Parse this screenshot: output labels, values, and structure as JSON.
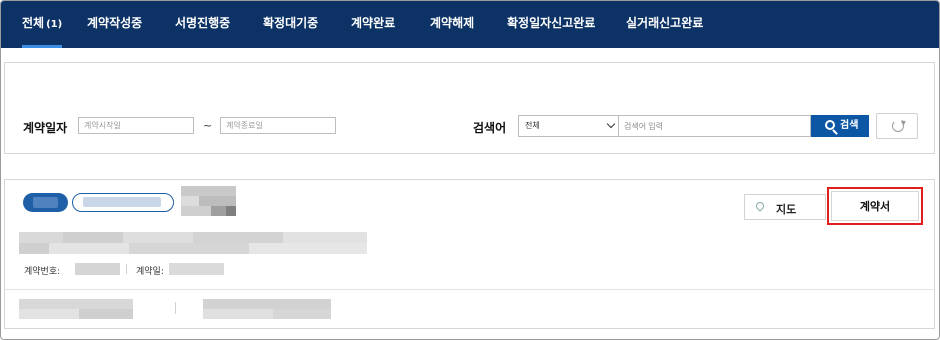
{
  "nav": {
    "tabs": [
      {
        "label": "전체",
        "count": "(1)",
        "active": true
      },
      {
        "label": "계약작성중"
      },
      {
        "label": "서명진행중"
      },
      {
        "label": "확정대기중"
      },
      {
        "label": "계약완료"
      },
      {
        "label": "계약해제"
      },
      {
        "label": "확정일자신고완료"
      },
      {
        "label": "실거래신고완료"
      }
    ]
  },
  "filter": {
    "date_label": "계약일자",
    "start_placeholder": "계약시작일",
    "end_placeholder": "계약종료일",
    "tilde": "~",
    "keyword_label": "검색어",
    "scope_value": "전체",
    "keyword_placeholder": "검색어 입력",
    "search_button": "검색"
  },
  "card": {
    "contract_no_label": "계약번호:",
    "contract_date_label": "계약일:",
    "map_button": "지도",
    "contract_button": "계약서"
  },
  "colors": {
    "nav_bg": "#0d3366",
    "accent": "#0b57a4",
    "highlight": "#e01e1e"
  }
}
